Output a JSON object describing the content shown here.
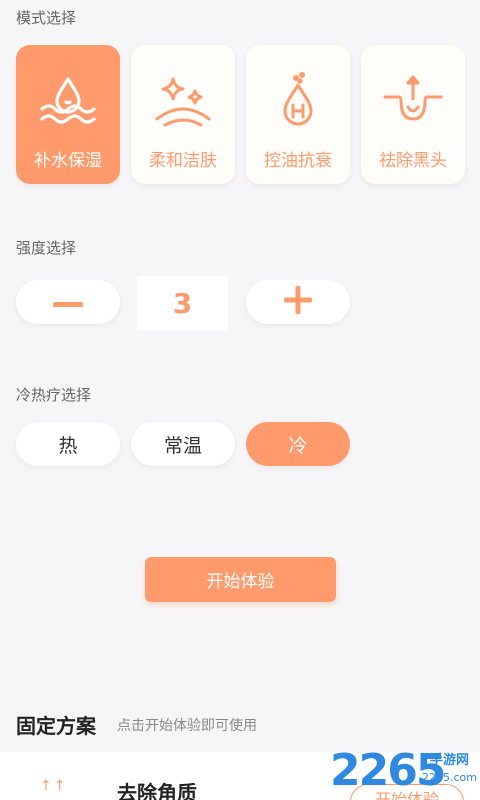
{
  "mode_section": {
    "label": "模式选择",
    "cards": [
      {
        "label": "补水保湿",
        "icon": "water-drop-wave-icon",
        "active": true
      },
      {
        "label": "柔和洁肤",
        "icon": "sparkle-icon",
        "active": false
      },
      {
        "label": "控油抗衰",
        "icon": "h-drop-icon",
        "active": false
      },
      {
        "label": "祛除黑头",
        "icon": "pore-extract-icon",
        "active": false
      }
    ]
  },
  "intensity_section": {
    "label": "强度选择",
    "minus": "−",
    "value": "3",
    "plus": "+"
  },
  "temp_section": {
    "label": "冷热疗选择",
    "options": [
      {
        "label": "热",
        "active": false
      },
      {
        "label": "常温",
        "active": false
      },
      {
        "label": "冷",
        "active": true
      }
    ]
  },
  "start_button": "开始体验",
  "fixed_plan": {
    "title": "固定方案",
    "hint": "点击开始体验即可使用",
    "items": [
      {
        "arrows": "↑↑",
        "name": "去除角质",
        "button": "开始体验"
      }
    ]
  },
  "watermark": {
    "number": "2265",
    "dot": "手游网",
    "domain": "2265.com"
  },
  "colors": {
    "accent": "#ff9a6c",
    "background": "#f6f6f8"
  }
}
